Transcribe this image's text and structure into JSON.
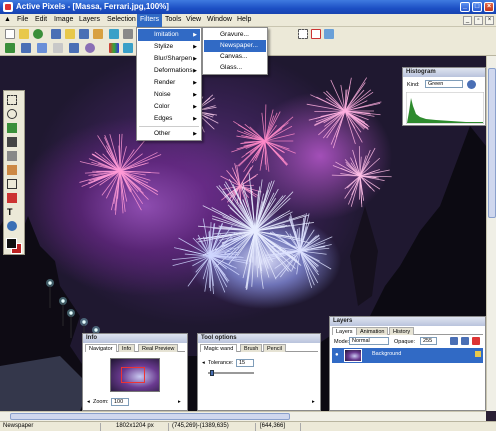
{
  "window": {
    "title": "Active Pixels - [Massa, Ferrari.jpg,100%]"
  },
  "menubar": {
    "items": [
      "File",
      "Edit",
      "Image",
      "Layers",
      "Selection",
      "Filters",
      "Tools",
      "View",
      "Window",
      "Help"
    ],
    "active": "Filters"
  },
  "filters_menu": {
    "items": [
      "Imitation",
      "Stylize",
      "Blur/Sharpen",
      "Deformations",
      "Render",
      "Noise",
      "Color",
      "Edges",
      "Other"
    ],
    "highlighted": "Imitation"
  },
  "imitation_menu": {
    "items": [
      "Gravure...",
      "Newspaper...",
      "Canvas...",
      "Glass..."
    ],
    "highlighted": "Newspaper..."
  },
  "histogram_panel": {
    "title": "Histogram",
    "kind_label": "Kind:",
    "kind_value": "Green"
  },
  "navigator_panel": {
    "title": "Info",
    "tabs": [
      "Navigator",
      "Info",
      "Real Preview"
    ],
    "zoom_label": "Zoom:",
    "zoom_value": "100"
  },
  "tool_options_panel": {
    "title": "Tool options",
    "tabs": [
      "Magic wand",
      "Brush",
      "Pencil"
    ],
    "tolerance_label": "Tolerance:",
    "tolerance_value": "15"
  },
  "layers_panel": {
    "title": "Layers",
    "tabs": [
      "Layers",
      "Animation",
      "History"
    ],
    "mode_label": "Mode:",
    "mode_value": "Normal",
    "opacity_label": "Opaque:",
    "opacity_value": "255",
    "layer_name": "Background"
  },
  "statusbar": {
    "hint": "Newspaper",
    "image_size": "1802x1204 px",
    "coords": "(745,269)-(1389,635)",
    "selection_size": "[644,366]"
  },
  "colors": {
    "title_bar": "#1c4fc4",
    "menu_highlight": "#316ac5",
    "chrome": "#ece9d8",
    "histogram_fill": "#2e8b2e"
  }
}
